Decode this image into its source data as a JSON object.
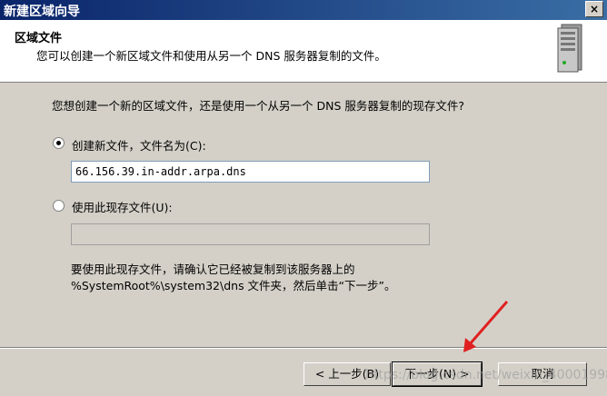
{
  "window": {
    "title": "新建区域向导",
    "close_glyph": "×"
  },
  "header": {
    "title": "区域文件",
    "subtitle": "您可以创建一个新区域文件和使用从另一个 DNS 服务器复制的文件。",
    "icon": "server-icon"
  },
  "main": {
    "question": "您想创建一个新的区域文件，还是使用一个从另一个 DNS 服务器复制的现存文件?",
    "option_new": {
      "label": "创建新文件，文件名为(C):",
      "selected": true,
      "value": "66.156.39.in-addr.arpa.dns"
    },
    "option_existing": {
      "label": "使用此现存文件(U):",
      "selected": false,
      "value": ""
    },
    "note_line1": "要使用此现存文件，请确认它已经被复制到该服务器上的",
    "note_line2": "%SystemRoot%\\system32\\dns 文件夹，然后单击“下一步”。"
  },
  "footer": {
    "back_label": "< 上一步(B)",
    "next_label": "下一步(N) >",
    "cancel_label": "取消"
  },
  "watermark": "https://blog.csdn.net/weixin_40001998",
  "colors": {
    "titlebar": "#0a246a",
    "dialog": "#d4d0c8",
    "annotation_arrow": "#e02020"
  }
}
